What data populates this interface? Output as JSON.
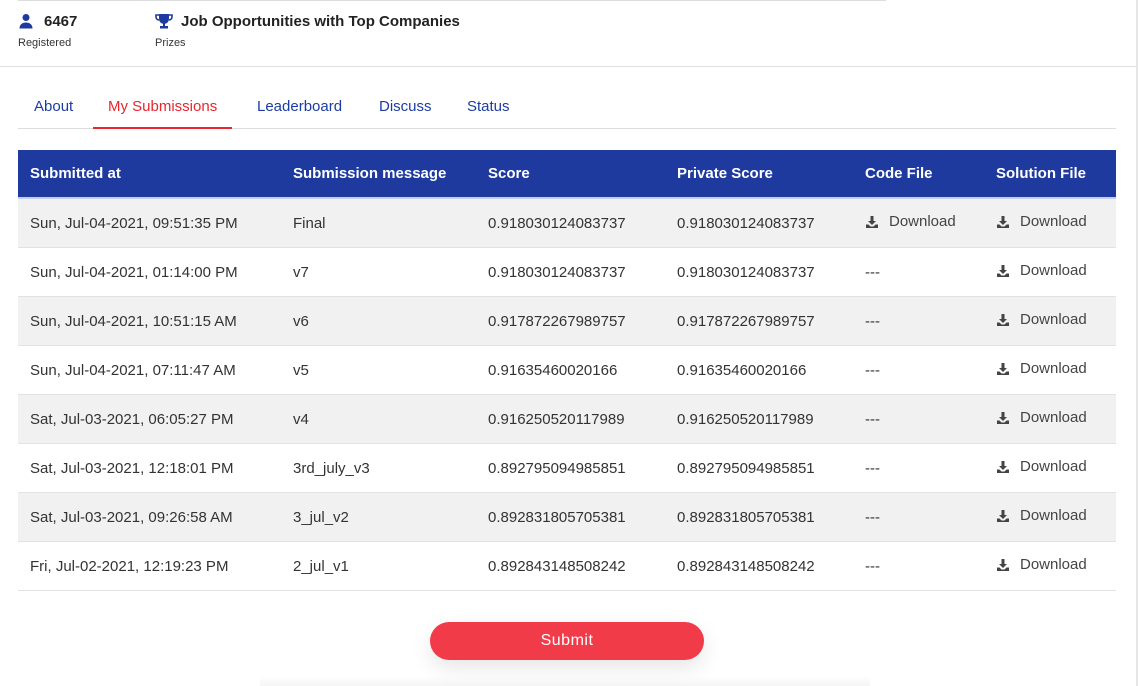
{
  "stats": {
    "registered": {
      "value": "6467",
      "label": "Registered",
      "icon": "user-icon"
    },
    "prizes": {
      "value": "Job Opportunities with Top Companies",
      "label": "Prizes",
      "icon": "trophy-icon"
    }
  },
  "tabs": [
    {
      "label": "About",
      "active": false
    },
    {
      "label": "My Submissions",
      "active": true
    },
    {
      "label": "Leaderboard",
      "active": false
    },
    {
      "label": "Discuss",
      "active": false
    },
    {
      "label": "Status",
      "active": false
    }
  ],
  "table": {
    "headers": [
      "Submitted at",
      "Submission message",
      "Score",
      "Private Score",
      "Code File",
      "Solution File"
    ],
    "rows": [
      {
        "submitted_at": "Sun, Jul-04-2021, 09:51:35 PM",
        "message": "Final",
        "score": "0.918030124083737",
        "private_score": "0.918030124083737",
        "code_file": "Download",
        "solution_file": "Download"
      },
      {
        "submitted_at": "Sun, Jul-04-2021, 01:14:00 PM",
        "message": "v7",
        "score": "0.918030124083737",
        "private_score": "0.918030124083737",
        "code_file": "---",
        "solution_file": "Download"
      },
      {
        "submitted_at": "Sun, Jul-04-2021, 10:51:15 AM",
        "message": "v6",
        "score": "0.917872267989757",
        "private_score": "0.917872267989757",
        "code_file": "---",
        "solution_file": "Download"
      },
      {
        "submitted_at": "Sun, Jul-04-2021, 07:11:47 AM",
        "message": "v5",
        "score": "0.91635460020166",
        "private_score": "0.91635460020166",
        "code_file": "---",
        "solution_file": "Download"
      },
      {
        "submitted_at": "Sat, Jul-03-2021, 06:05:27 PM",
        "message": "v4",
        "score": "0.916250520117989",
        "private_score": "0.916250520117989",
        "code_file": "---",
        "solution_file": "Download"
      },
      {
        "submitted_at": "Sat, Jul-03-2021, 12:18:01 PM",
        "message": "3rd_july_v3",
        "score": "0.892795094985851",
        "private_score": "0.892795094985851",
        "code_file": "---",
        "solution_file": "Download"
      },
      {
        "submitted_at": "Sat, Jul-03-2021, 09:26:58 AM",
        "message": "3_jul_v2",
        "score": "0.892831805705381",
        "private_score": "0.892831805705381",
        "code_file": "---",
        "solution_file": "Download"
      },
      {
        "submitted_at": "Fri, Jul-02-2021, 12:19:23 PM",
        "message": "2_jul_v1",
        "score": "0.892843148508242",
        "private_score": "0.892843148508242",
        "code_file": "---",
        "solution_file": "Download"
      }
    ]
  },
  "submit_label": "Submit",
  "colors": {
    "header_bg": "#1e3a9f",
    "accent_red": "#e8262e",
    "tab_blue": "#1c3ca3",
    "submit_bg": "#f23b49"
  }
}
